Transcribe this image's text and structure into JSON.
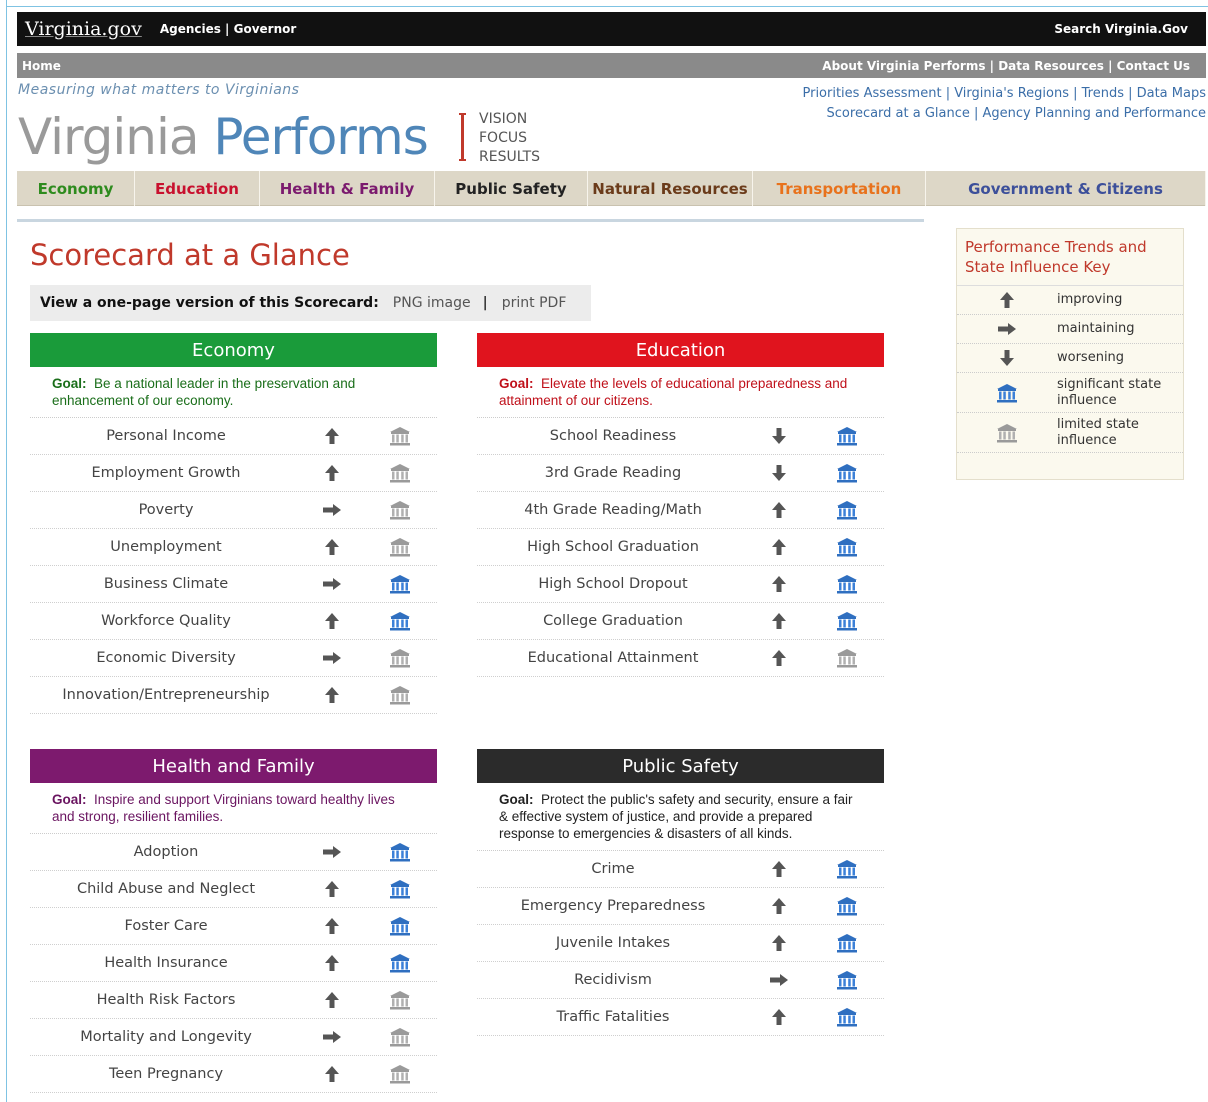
{
  "topbar": {
    "logo": "Virginia.gov",
    "agencies": "Agencies | Governor",
    "search": "Search Virginia.Gov"
  },
  "greybar": {
    "home": "Home",
    "links": "About Virginia Performs | Data Resources | Contact Us"
  },
  "tagline": "Measuring what matters to Virginians",
  "toplinks": {
    "line1": "Priorities Assessment | Virginia's Regions | Trends | Data Maps",
    "line2": "Scorecard at a Glance | Agency Planning and Performance"
  },
  "brand": {
    "part1": "Virginia",
    "part2": " Performs",
    "vfr1": "VISION",
    "vfr2": "FOCUS",
    "vfr3": "RESULTS"
  },
  "nav": [
    {
      "label": "Economy",
      "color": "#2e8b1e"
    },
    {
      "label": "Education",
      "color": "#c8102e"
    },
    {
      "label": "Health & Family",
      "color": "#7b1a6e"
    },
    {
      "label": "Public Safety",
      "color": "#222222"
    },
    {
      "label": "Natural Resources",
      "color": "#6b3b1a"
    },
    {
      "label": "Transportation",
      "color": "#e8721c"
    },
    {
      "label": "Government & Citizens",
      "color": "#3c4f9a"
    }
  ],
  "page_title": "Scorecard at a Glance",
  "version": {
    "label": "View a one-page version of this Scorecard:",
    "png": "PNG image",
    "sep": "|",
    "pdf": "print PDF"
  },
  "panels": {
    "economy": {
      "title": "Economy",
      "color": "#1a9b3a",
      "goal_color": "#1a6e1a",
      "goal_label": "Goal:",
      "goal": "Be a national leader in the preservation and enhancement of our economy.",
      "rows": [
        {
          "name": "Personal Income",
          "trend": "improving",
          "influence": "limited"
        },
        {
          "name": "Employment Growth",
          "trend": "improving",
          "influence": "limited"
        },
        {
          "name": "Poverty",
          "trend": "maintaining",
          "influence": "limited"
        },
        {
          "name": "Unemployment",
          "trend": "improving",
          "influence": "limited"
        },
        {
          "name": "Business Climate",
          "trend": "maintaining",
          "influence": "significant"
        },
        {
          "name": "Workforce Quality",
          "trend": "improving",
          "influence": "significant"
        },
        {
          "name": "Economic Diversity",
          "trend": "maintaining",
          "influence": "limited"
        },
        {
          "name": "Innovation/Entrepreneurship",
          "trend": "improving",
          "influence": "limited"
        }
      ]
    },
    "education": {
      "title": "Education",
      "color": "#e0141e",
      "goal_color": "#c0101a",
      "goal_label": "Goal:",
      "goal": "Elevate the levels of educational preparedness and attainment of our citizens.",
      "rows": [
        {
          "name": "School Readiness",
          "trend": "worsening",
          "influence": "significant"
        },
        {
          "name": "3rd Grade Reading",
          "trend": "worsening",
          "influence": "significant"
        },
        {
          "name": "4th Grade Reading/Math",
          "trend": "improving",
          "influence": "significant"
        },
        {
          "name": "High School Graduation",
          "trend": "improving",
          "influence": "significant"
        },
        {
          "name": "High School Dropout",
          "trend": "improving",
          "influence": "significant"
        },
        {
          "name": "College Graduation",
          "trend": "improving",
          "influence": "significant"
        },
        {
          "name": "Educational Attainment",
          "trend": "improving",
          "influence": "limited"
        }
      ]
    },
    "health": {
      "title": "Health and Family",
      "color": "#7d1a6e",
      "goal_color": "#6a1460",
      "goal_label": "Goal:",
      "goal": "Inspire and support Virginians toward healthy lives and strong, resilient families.",
      "rows": [
        {
          "name": "Adoption",
          "trend": "maintaining",
          "influence": "significant"
        },
        {
          "name": "Child Abuse and Neglect",
          "trend": "improving",
          "influence": "significant"
        },
        {
          "name": "Foster Care",
          "trend": "improving",
          "influence": "significant"
        },
        {
          "name": "Health Insurance",
          "trend": "improving",
          "influence": "significant"
        },
        {
          "name": "Health Risk Factors",
          "trend": "improving",
          "influence": "limited"
        },
        {
          "name": "Mortality and Longevity",
          "trend": "maintaining",
          "influence": "limited"
        },
        {
          "name": "Teen Pregnancy",
          "trend": "improving",
          "influence": "limited"
        }
      ]
    },
    "safety": {
      "title": "Public Safety",
      "color": "#2b2b2b",
      "goal_color": "#222222",
      "goal_label": "Goal:",
      "goal": "Protect the public's safety and security, ensure a fair & effective system of justice, and provide a prepared response to emergencies & disasters of all kinds.",
      "rows": [
        {
          "name": "Crime",
          "trend": "improving",
          "influence": "significant"
        },
        {
          "name": "Emergency Preparedness",
          "trend": "improving",
          "influence": "significant"
        },
        {
          "name": "Juvenile Intakes",
          "trend": "improving",
          "influence": "significant"
        },
        {
          "name": "Recidivism",
          "trend": "maintaining",
          "influence": "significant"
        },
        {
          "name": "Traffic Fatalities",
          "trend": "improving",
          "influence": "significant"
        }
      ]
    }
  },
  "key": {
    "title": "Performance Trends and State Influence Key",
    "rows": [
      {
        "icon": "improving",
        "label": "improving"
      },
      {
        "icon": "maintaining",
        "label": "maintaining"
      },
      {
        "icon": "worsening",
        "label": "worsening"
      },
      {
        "icon": "significant",
        "label": "significant state influence"
      },
      {
        "icon": "limited",
        "label": "limited state influence"
      }
    ]
  }
}
